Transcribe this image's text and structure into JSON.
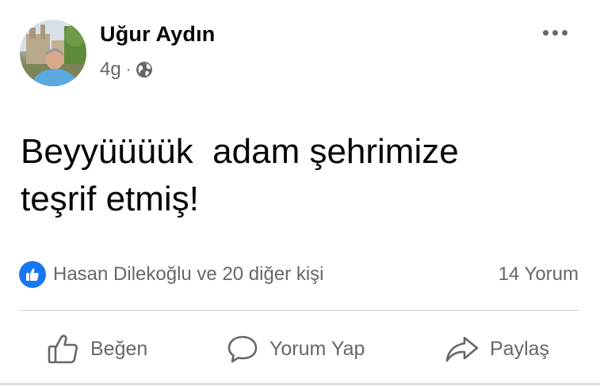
{
  "post": {
    "author": "Uğur Aydın",
    "time": "4g",
    "separator": "·",
    "privacy_icon": "globe-icon",
    "menu_icon": "more-horizontal-icon",
    "content": "Beyyüüüük  adam şehrimize\nteşrif etmiş!"
  },
  "reactions": {
    "icon": "like-reaction-icon",
    "summary": "Hasan Dilekoğlu ve 20 diğer kişi",
    "comments": "14 Yorum"
  },
  "actions": [
    {
      "label": "Beğen",
      "icon": "thumbs-up-icon"
    },
    {
      "label": "Yorum Yap",
      "icon": "comment-icon"
    },
    {
      "label": "Paylaş",
      "icon": "share-arrow-icon"
    }
  ],
  "colors": {
    "accent": "#1877f2",
    "secondary_text": "#65676b",
    "primary_text": "#050505",
    "divider": "#ced0d4"
  }
}
